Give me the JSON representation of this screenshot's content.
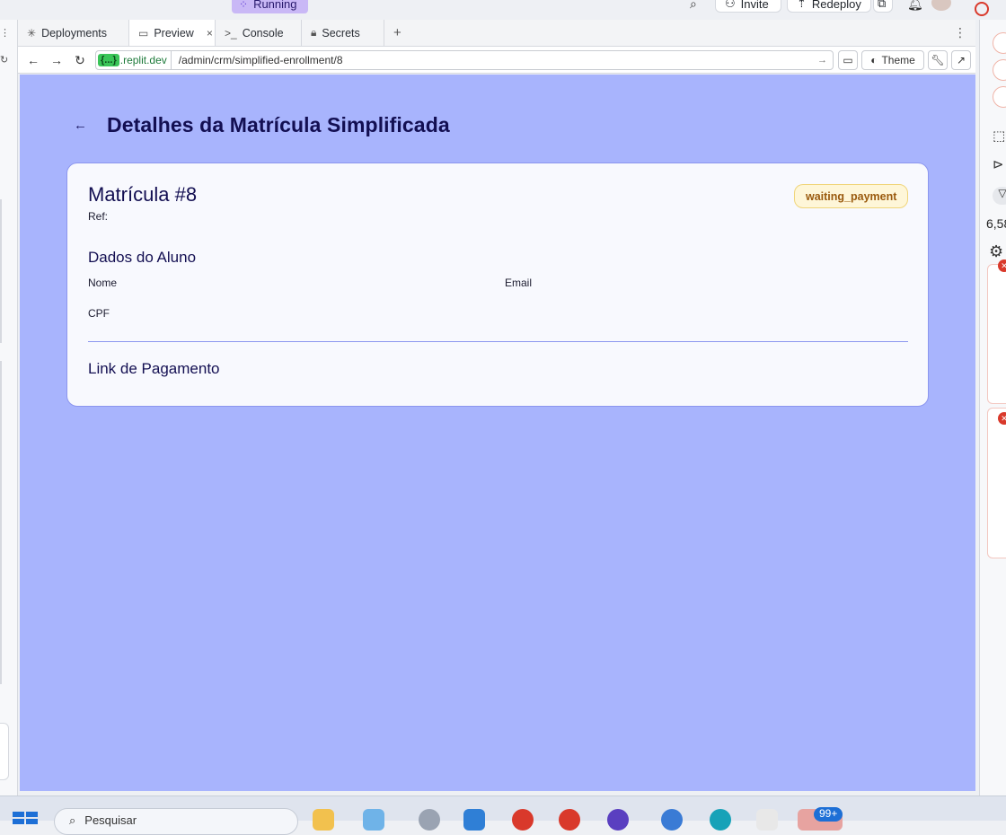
{
  "top": {
    "running_label": "Running",
    "invite_label": "Invite",
    "redeploy_label": "Redeploy"
  },
  "tabs": [
    {
      "label": "Deployments",
      "icon": "deployments-icon"
    },
    {
      "label": "Preview",
      "icon": "monitor-icon",
      "active": true
    },
    {
      "label": "Console",
      "icon": "terminal-icon"
    },
    {
      "label": "Secrets",
      "icon": "lock-icon"
    }
  ],
  "address": {
    "host_badge": "{...}",
    "host": ".replit.dev",
    "path": "/admin/crm/simplified-enrollment/8",
    "theme_label": "Theme"
  },
  "page": {
    "title": "Detalhes da Matrícula Simplificada",
    "enrollment_title": "Matrícula #8",
    "ref_label": "Ref:",
    "status": "waiting_payment",
    "student_section": "Dados do Aluno",
    "name_label": "Nome",
    "email_label": "Email",
    "cpf_label": "CPF",
    "payment_section": "Link de Pagamento"
  },
  "right_panel": {
    "count_text": "6,58"
  },
  "taskbar": {
    "search_placeholder": "Pesquisar",
    "notification_count": "99+"
  },
  "colors": {
    "preview_bg": "#a8b4fd",
    "title_color": "#130f52",
    "badge_bg": "#fef6d8",
    "badge_text": "#9a5a0e"
  }
}
